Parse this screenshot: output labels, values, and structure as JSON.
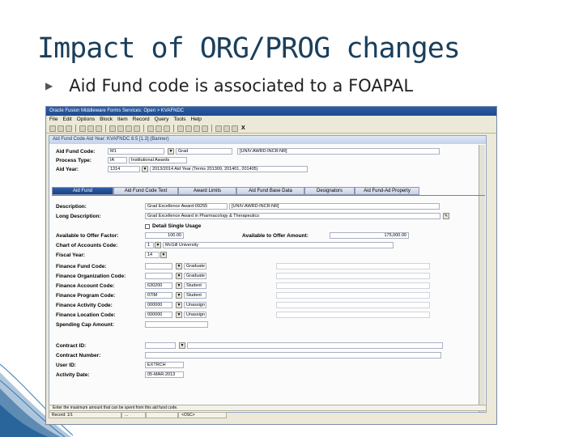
{
  "slide": {
    "title": "Impact of ORG/PROG changes",
    "bullet": "Aid Fund code is associated to a FOAPAL"
  },
  "window": {
    "title": "Oracle Fusion Middleware Forms Services: Open > KVAFNDC",
    "menu": [
      "File",
      "Edit",
      "Options",
      "Block",
      "Item",
      "Record",
      "Query",
      "Tools",
      "Help"
    ],
    "close_glyph": "X"
  },
  "form": {
    "title": "Aid Fund Code Aid Year: KVAFNDC 8.5 [1.3] (Banner)",
    "aid_fund_code_label": "Aid Fund Code:",
    "aid_fund_code_value": "M1",
    "aid_fund_code_desc": "Grad",
    "aid_fund_code_extra": "[UNIV:AWRD:INCR:NR]",
    "process_type_label": "Process Type:",
    "process_type_value": "IA",
    "process_type_desc": "Institutional Awards",
    "aid_year_label": "Aid Year:",
    "aid_year_value": "1314",
    "aid_year_desc": "2013/2014 Aid Year (Terms 201309, 201401, 201405)"
  },
  "tabs": [
    {
      "label": "Aid Fund",
      "active": true
    },
    {
      "label": "Aid Fund Code Text",
      "active": false
    },
    {
      "label": "Award Limits",
      "active": false
    },
    {
      "label": "Aid Fund Base Data",
      "active": false
    },
    {
      "label": "Designators",
      "active": false
    },
    {
      "label": "Aid Fund-Ad Property",
      "active": false
    }
  ],
  "detail": {
    "description_label": "Description:",
    "description_value": "Grad Excellence Award-09255",
    "description_extra": "[UNIV:AWRD:INCR:NR]",
    "long_description_label": "Long Description:",
    "long_description_value": "Grad Excellence Award in Pharmacology & Therapeutics",
    "detail_single_usage_label": "Detail Single Usage",
    "available_factor_label": "Available to Offer Factor:",
    "available_factor_value": "100.00",
    "available_amount_label": "Available to Offer Amount:",
    "available_amount_value": "175,000.00",
    "coa_label": "Chart of Accounts Code:",
    "coa_value": "1",
    "coa_desc": "McGill University",
    "fiscal_year_label": "Fiscal Year:",
    "fiscal_year_value": "14",
    "fund_label": "Finance Fund Code:",
    "fund_desc": "Graduate",
    "org_label": "Finance Organization Code:",
    "org_desc": "Graduate",
    "account_label": "Finance Account Code:",
    "account_value": "630200",
    "account_desc": "Student",
    "program_label": "Finance Program Code:",
    "program_value": "07IM",
    "program_desc": "Student",
    "activity_label": "Finance Activity Code:",
    "activity_value": "000000",
    "activity_desc": "Unassign",
    "location_label": "Finance Location Code:",
    "location_value": "000000",
    "location_desc": "Unassign",
    "spending_cap_label": "Spending Cap Amount:",
    "contract_id_label": "Contract ID:",
    "contract_number_label": "Contract Number:",
    "user_id_label": "User ID:",
    "user_id_value": "EXTRCH",
    "activity_date_label": "Activity Date:",
    "activity_date_value": "05-MAR-2013"
  },
  "status": {
    "message": "Enter the maximum amount that can be spent from this aid fund code.",
    "record": "Record: 1/1",
    "cell2": "...",
    "cell3": "",
    "cell4": "<OSC>"
  },
  "colors": {
    "title": "#1a3f5c",
    "wave": "#1b5b95"
  }
}
